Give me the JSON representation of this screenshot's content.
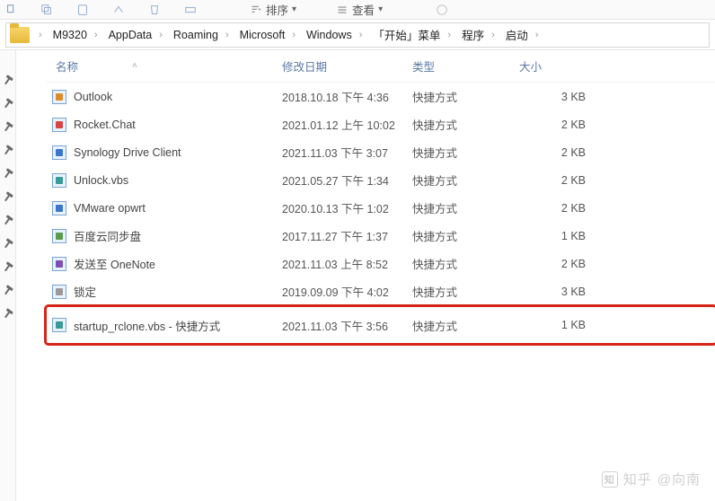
{
  "toolbar": {
    "sort_label": "排序",
    "view_label": "查看"
  },
  "breadcrumbs": [
    "M9320",
    "AppData",
    "Roaming",
    "Microsoft",
    "Windows",
    "「开始」菜单",
    "程序",
    "启动"
  ],
  "columns": {
    "name": "名称",
    "date": "修改日期",
    "type": "类型",
    "size": "大小"
  },
  "files": [
    {
      "icon": "c-orange",
      "name": "Outlook",
      "date": "2018.10.18 下午 4:36",
      "type": "快捷方式",
      "size": "3 KB",
      "highlight": false
    },
    {
      "icon": "c-red",
      "name": "Rocket.Chat",
      "date": "2021.01.12 上午 10:02",
      "type": "快捷方式",
      "size": "2 KB",
      "highlight": false
    },
    {
      "icon": "c-blue",
      "name": "Synology Drive Client",
      "date": "2021.11.03 下午 3:07",
      "type": "快捷方式",
      "size": "2 KB",
      "highlight": false
    },
    {
      "icon": "c-teal",
      "name": "Unlock.vbs",
      "date": "2021.05.27 下午 1:34",
      "type": "快捷方式",
      "size": "2 KB",
      "highlight": false
    },
    {
      "icon": "c-blue",
      "name": "VMware opwrt",
      "date": "2020.10.13 下午 1:02",
      "type": "快捷方式",
      "size": "2 KB",
      "highlight": false
    },
    {
      "icon": "c-green",
      "name": "百度云同步盘",
      "date": "2017.11.27 下午 1:37",
      "type": "快捷方式",
      "size": "1 KB",
      "highlight": false
    },
    {
      "icon": "c-purple",
      "name": "发送至 OneNote",
      "date": "2021.11.03 上午 8:52",
      "type": "快捷方式",
      "size": "2 KB",
      "highlight": false
    },
    {
      "icon": "c-grey",
      "name": "锁定",
      "date": "2019.09.09 下午 4:02",
      "type": "快捷方式",
      "size": "3 KB",
      "highlight": false
    },
    {
      "icon": "c-teal",
      "name": "startup_rclone.vbs - 快捷方式",
      "date": "2021.11.03 下午 3:56",
      "type": "快捷方式",
      "size": "1 KB",
      "highlight": true
    }
  ],
  "watermark": {
    "site": "知乎",
    "at": "@向南"
  }
}
